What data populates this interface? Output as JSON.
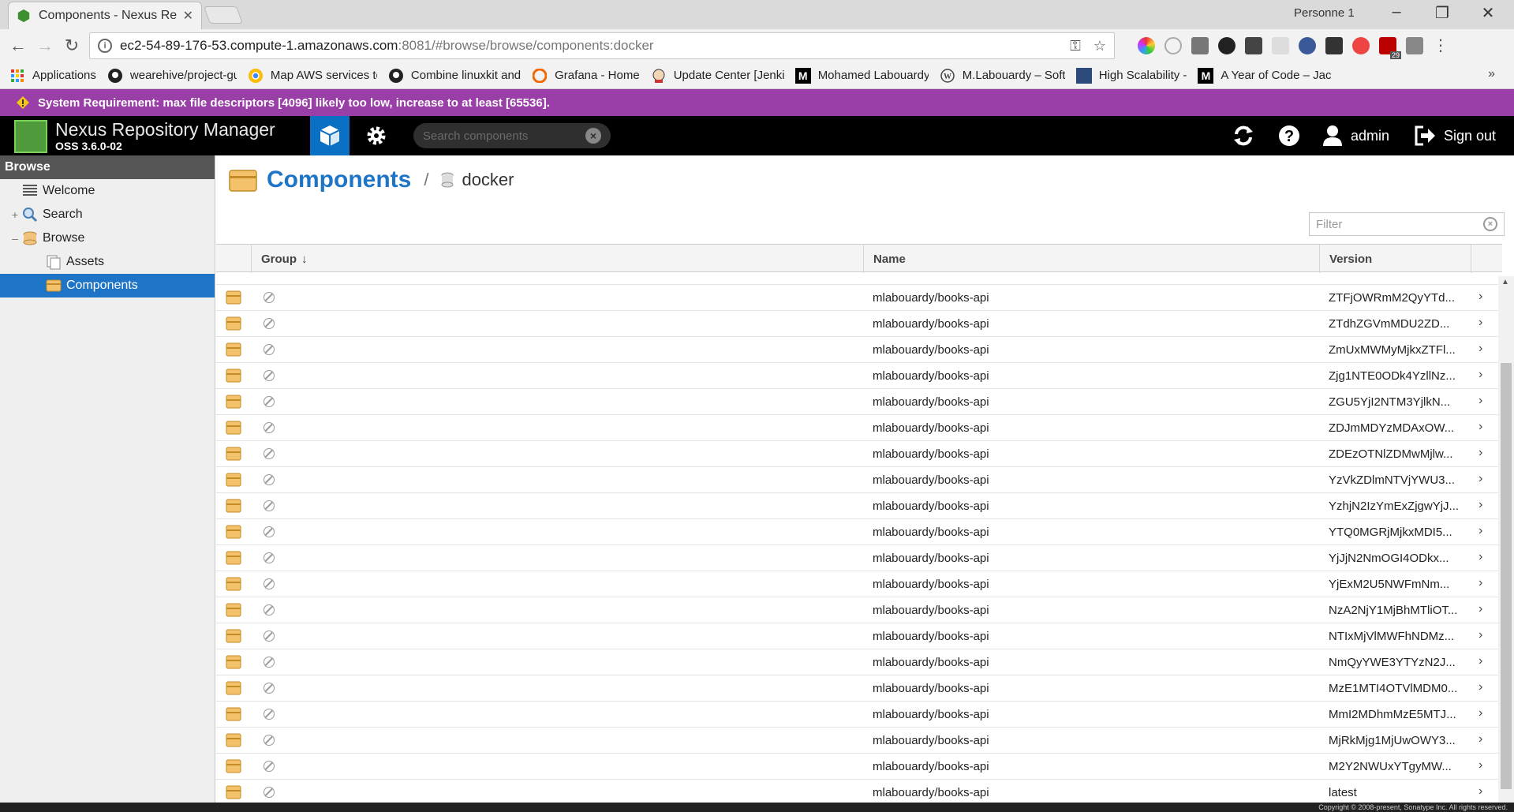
{
  "browser": {
    "tab_title": "Components - Nexus Re",
    "profile": "Personne 1",
    "url_host": "ec2-54-89-176-53.compute-1.amazonaws.com",
    "url_rest": ":8081/#browse/browse/components:docker",
    "bookmarks": [
      {
        "label": "Applications",
        "icon": "apps-grid-icon"
      },
      {
        "label": "wearehive/project-gu",
        "icon": "github-icon"
      },
      {
        "label": "Map AWS services to",
        "icon": "chrome-icon"
      },
      {
        "label": "Combine linuxkit and",
        "icon": "github-icon"
      },
      {
        "label": "Grafana - Home",
        "icon": "grafana-icon"
      },
      {
        "label": "Update Center [Jenki",
        "icon": "jenkins-icon"
      },
      {
        "label": "Mohamed Labouardy",
        "icon": "medium-icon"
      },
      {
        "label": "M.Labouardy – Softw",
        "icon": "wordpress-icon"
      },
      {
        "label": "High Scalability -",
        "icon": "highscal-icon"
      },
      {
        "label": "A Year of Code – Jack",
        "icon": "medium-icon"
      }
    ],
    "bookmarks_more": "»",
    "ext_badge": "29"
  },
  "system_message": "System Requirement: max file descriptors [4096] likely too low, increase to at least [65536].",
  "app": {
    "name": "Nexus Repository Manager",
    "version": "OSS 3.6.0-02",
    "search_placeholder": "Search components",
    "user": "admin",
    "sign_out": "Sign out"
  },
  "sidebar": {
    "title": "Browse",
    "items": [
      {
        "label": "Welcome",
        "expander": ""
      },
      {
        "label": "Search",
        "expander": "+"
      },
      {
        "label": "Browse",
        "expander": "–"
      },
      {
        "label": "Assets",
        "expander": ""
      },
      {
        "label": "Components",
        "expander": ""
      }
    ]
  },
  "main": {
    "title": "Components",
    "separator": "/",
    "repo": "docker",
    "filter_placeholder": "Filter",
    "columns": {
      "group": "Group",
      "name": "Name",
      "version": "Version"
    },
    "sort_indicator": "↓",
    "rows": [
      {
        "name": "mlabouardy/books-api",
        "version": "ZTFjOWRmM2QyYTd..."
      },
      {
        "name": "mlabouardy/books-api",
        "version": "ZTdhZGVmMDU2ZD..."
      },
      {
        "name": "mlabouardy/books-api",
        "version": "ZmUxMWMyMjkxZTFl..."
      },
      {
        "name": "mlabouardy/books-api",
        "version": "Zjg1NTE0ODk4YzllNz..."
      },
      {
        "name": "mlabouardy/books-api",
        "version": "ZGU5YjI2NTM3YjlkN..."
      },
      {
        "name": "mlabouardy/books-api",
        "version": "ZDJmMDYzMDAxOW..."
      },
      {
        "name": "mlabouardy/books-api",
        "version": "ZDEzOTNlZDMwMjlw..."
      },
      {
        "name": "mlabouardy/books-api",
        "version": "YzVkZDlmNTVjYWU3..."
      },
      {
        "name": "mlabouardy/books-api",
        "version": "YzhjN2IzYmExZjgwYjJ..."
      },
      {
        "name": "mlabouardy/books-api",
        "version": "YTQ0MGRjMjkxMDI5..."
      },
      {
        "name": "mlabouardy/books-api",
        "version": "YjJjN2NmOGI4ODkx..."
      },
      {
        "name": "mlabouardy/books-api",
        "version": "YjExM2U5NWFmNm..."
      },
      {
        "name": "mlabouardy/books-api",
        "version": "NzA2NjY1MjBhMTliOT..."
      },
      {
        "name": "mlabouardy/books-api",
        "version": "NTIxMjVlMWFhNDMz..."
      },
      {
        "name": "mlabouardy/books-api",
        "version": "NmQyYWE3YTYzN2J..."
      },
      {
        "name": "mlabouardy/books-api",
        "version": "MzE1MTI4OTVlMDM0..."
      },
      {
        "name": "mlabouardy/books-api",
        "version": "MmI2MDhmMzE5MTJ..."
      },
      {
        "name": "mlabouardy/books-api",
        "version": "MjRkMjg1MjUwOWY3..."
      },
      {
        "name": "mlabouardy/books-api",
        "version": "M2Y2NWUxYTgyMW..."
      },
      {
        "name": "mlabouardy/books-api",
        "version": "latest"
      }
    ]
  },
  "footer": "Copyright © 2008-present, Sonatype Inc. All rights reserved."
}
